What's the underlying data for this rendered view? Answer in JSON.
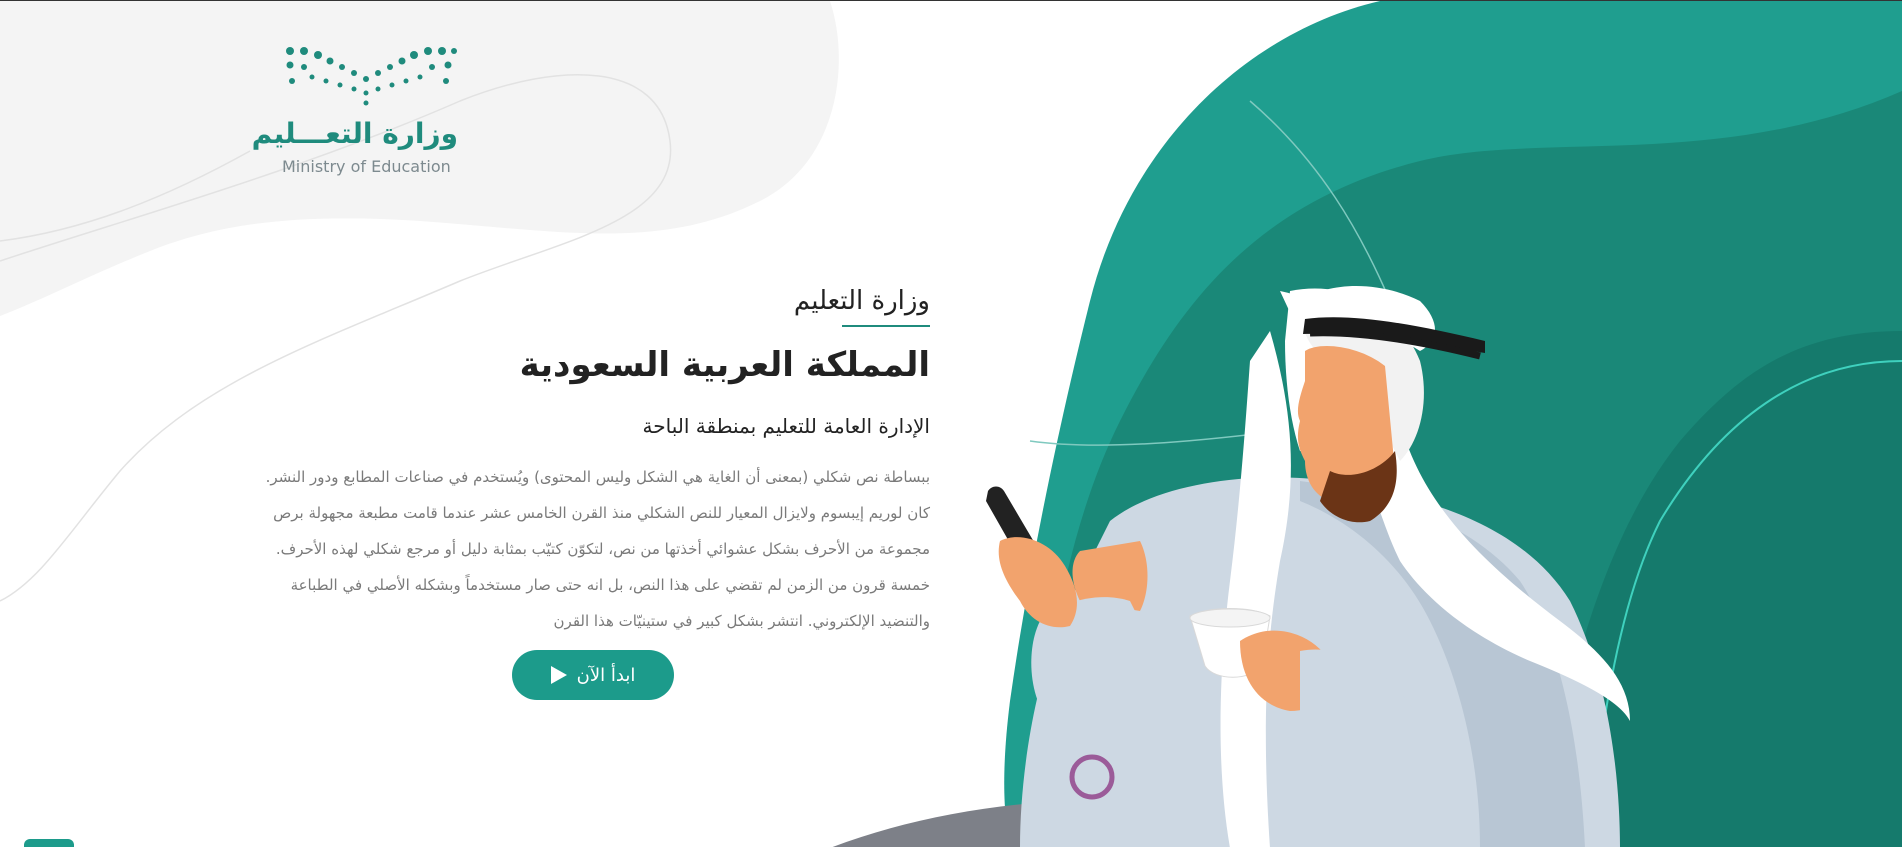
{
  "logo": {
    "name_ar": "وزارة التعـــليم",
    "name_en": "Ministry of Education"
  },
  "hero": {
    "ministry_title": "وزارة التعليم",
    "kingdom_title": "المملكة العربية السعودية",
    "admin_title": "الإدارة العامة للتعليم بمنطقة الباحة",
    "description_lines": [
      "ببساطة نص شكلي (بمعنى أن الغاية هي الشكل وليس المحتوى) ويُستخدم في صناعات المطابع ودور النشر.",
      "كان لوريم إيبسوم ولايزال المعيار للنص الشكلي منذ القرن الخامس عشر عندما قامت مطبعة مجهولة برص",
      "مجموعة من الأحرف بشكل عشوائي أخذتها من نص، لتكوّن كتيّب بمثابة دليل أو مرجع شكلي لهذه الأحرف.",
      "خمسة قرون من الزمن لم تقضي على هذا النص، بل انه حتى صار مستخدماً وبشكله الأصلي في الطباعة",
      "والتنضيد الإلكتروني. انتشر بشكل كبير في ستينيّات هذا القرن"
    ]
  },
  "cta": {
    "label": "ابدأ الآن",
    "icon": "play-icon"
  },
  "colors": {
    "brand_teal": "#1c9b8b",
    "dark_teal": "#15766a",
    "light_gray_bg": "#f4f4f4"
  }
}
